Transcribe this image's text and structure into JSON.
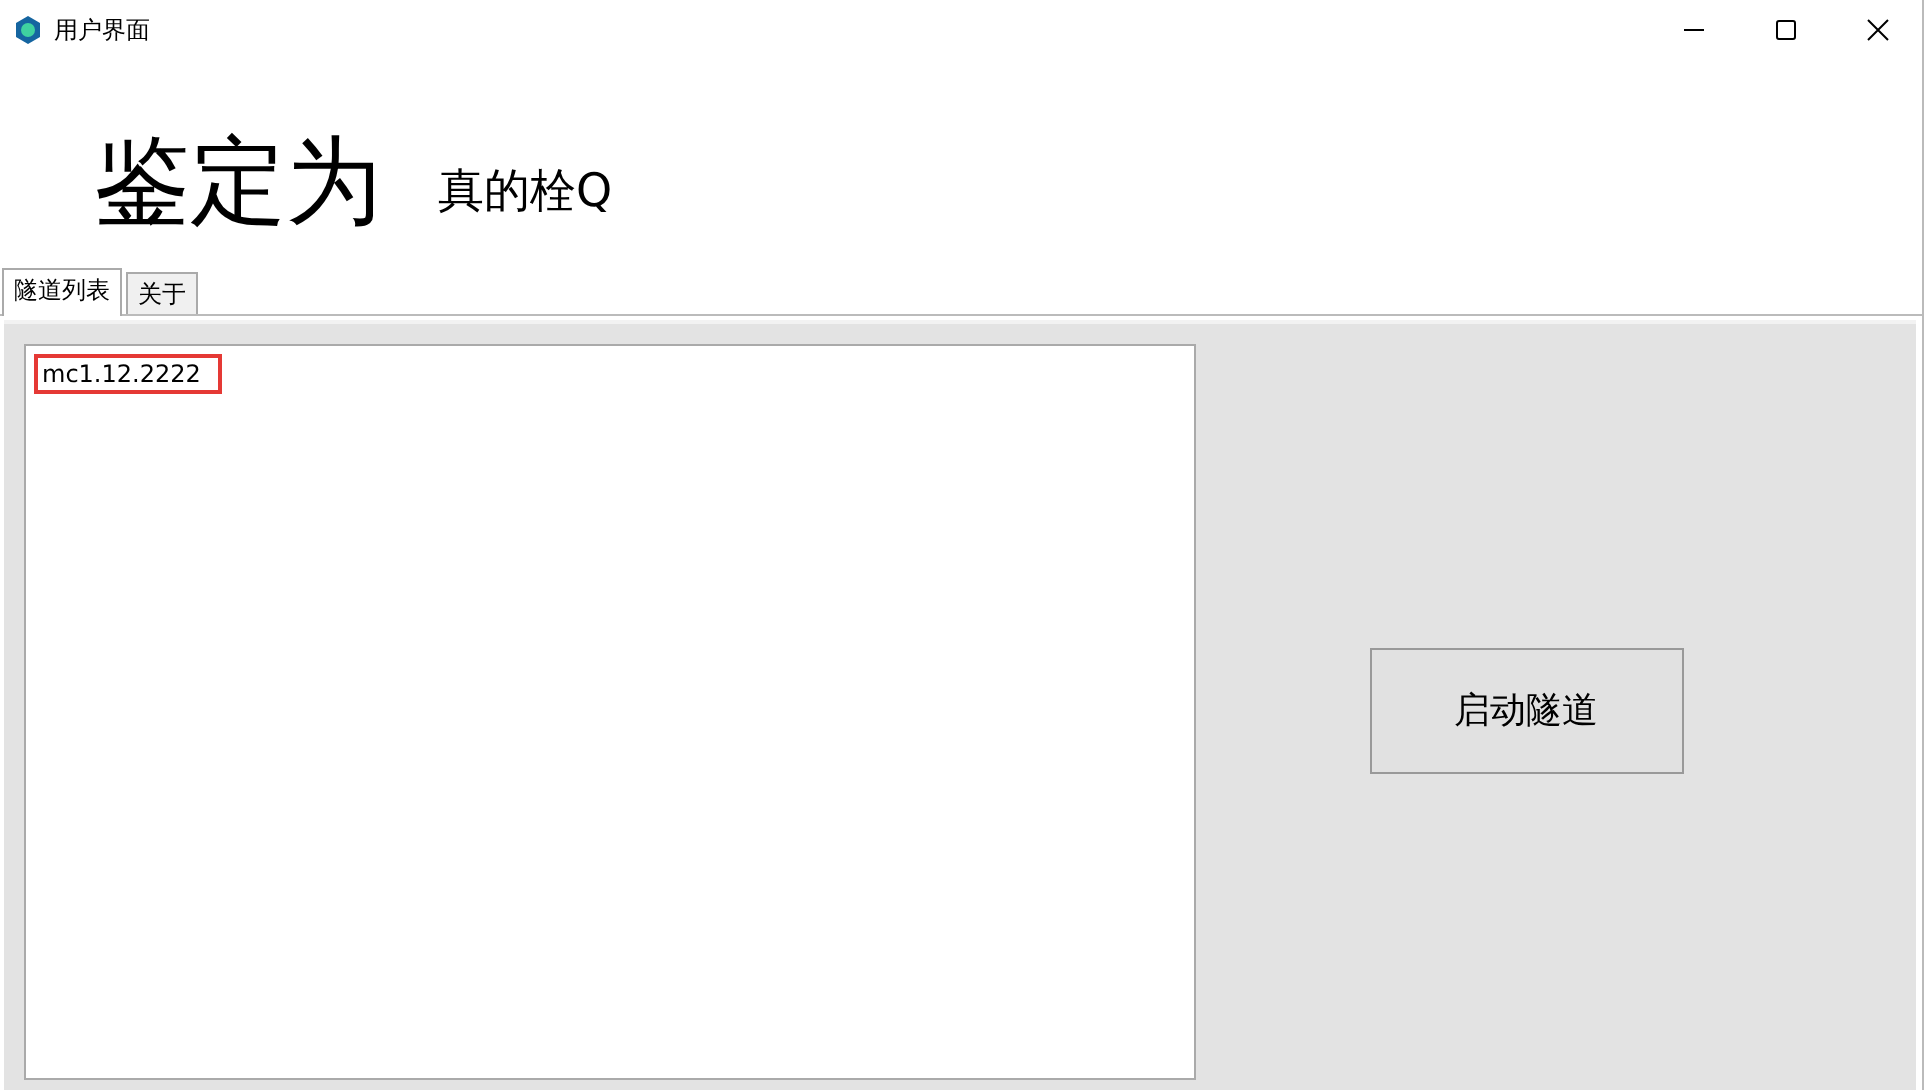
{
  "window": {
    "title": "用户界面"
  },
  "header": {
    "title": "鉴定为",
    "subtitle": "真的栓Q"
  },
  "tabs": [
    {
      "label": "隧道列表",
      "selected": true
    },
    {
      "label": "关于",
      "selected": false
    }
  ],
  "tunnel_list": {
    "items": [
      {
        "label": "mc1.12.2222",
        "highlighted": true
      }
    ]
  },
  "start_button": {
    "label": "启动隧道"
  }
}
